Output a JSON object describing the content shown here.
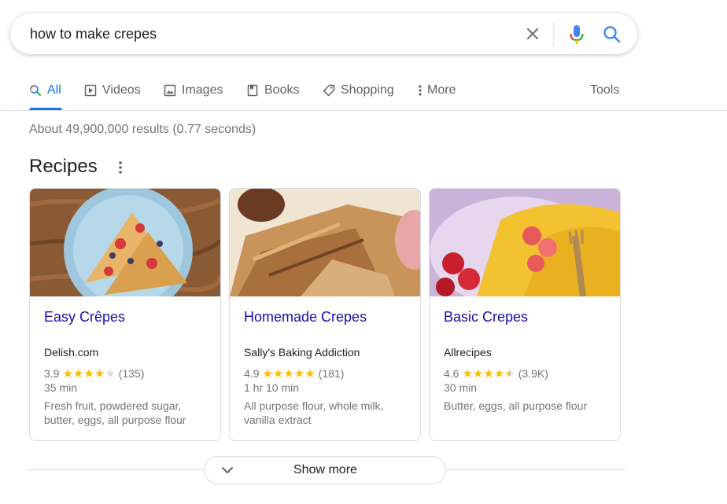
{
  "search": {
    "query": "how to make crepes",
    "clear_icon": "close-icon",
    "mic_icon": "mic-icon",
    "search_icon": "search-icon"
  },
  "tabs": [
    {
      "label": "All",
      "icon": "search-icon",
      "active": true
    },
    {
      "label": "Videos",
      "icon": "play-icon"
    },
    {
      "label": "Images",
      "icon": "image-icon"
    },
    {
      "label": "Books",
      "icon": "book-icon"
    },
    {
      "label": "Shopping",
      "icon": "tag-icon"
    },
    {
      "label": "More",
      "icon": "more-vert-icon"
    }
  ],
  "tools_label": "Tools",
  "result_stats": "About 49,900,000 results (0.77 seconds)",
  "recipes": {
    "title": "Recipes",
    "cards": [
      {
        "title": "Easy Crêpes",
        "source": "Delish.com",
        "rating": "3.9",
        "rating_value": 3.9,
        "reviews": "(135)",
        "time": "35 min",
        "ingredients": "Fresh fruit, powdered sugar, butter, eggs, all purpose flour"
      },
      {
        "title": "Homemade Crepes",
        "source": "Sally's Baking Addiction",
        "rating": "4.9",
        "rating_value": 4.9,
        "reviews": "(181)",
        "time": "1 hr 10 min",
        "ingredients": "All purpose flour, whole milk, vanilla extract"
      },
      {
        "title": "Basic Crepes",
        "source": "Allrecipes",
        "rating": "4.6",
        "rating_value": 4.6,
        "reviews": "(3.9K)",
        "time": "30 min",
        "ingredients": "Butter, eggs, all purpose flour"
      }
    ]
  },
  "show_more_label": "Show more",
  "colors": {
    "link": "#1a0dab",
    "accent": "#1a73e8",
    "star": "#fbbc04",
    "secondary_text": "#70757a"
  }
}
